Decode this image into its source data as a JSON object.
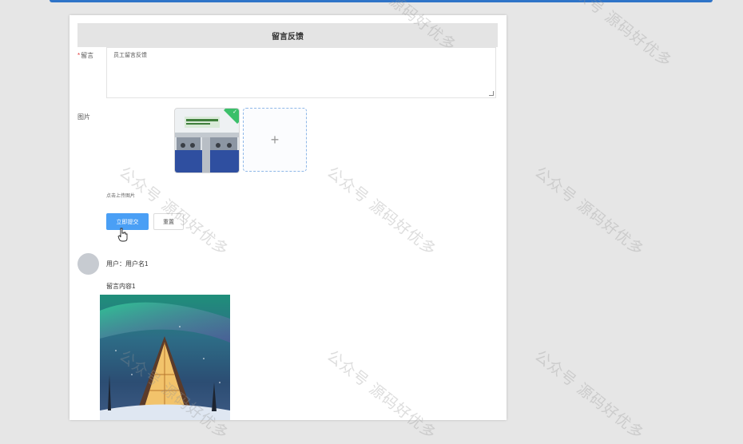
{
  "form": {
    "title": "留言反馈",
    "message_label": "留言",
    "message_value": "员工留言反馈",
    "image_label": "图片",
    "upload_tip": "点击上传图片",
    "submit_label": "立即提交",
    "reset_label": "重置"
  },
  "comment": {
    "user_line": "用户：用户名1",
    "content": "留言内容1"
  },
  "watermark_text": "公众号 源码好优多",
  "colors": {
    "primary": "#4a9ff5",
    "success": "#3bbf6a",
    "required": "#e23c3c",
    "header_bg": "#e4e4e4",
    "page_bg": "#e6e6e6"
  },
  "icons": {
    "upload": "plus-icon",
    "check": "check-icon",
    "cursor": "hand-pointer-icon"
  }
}
